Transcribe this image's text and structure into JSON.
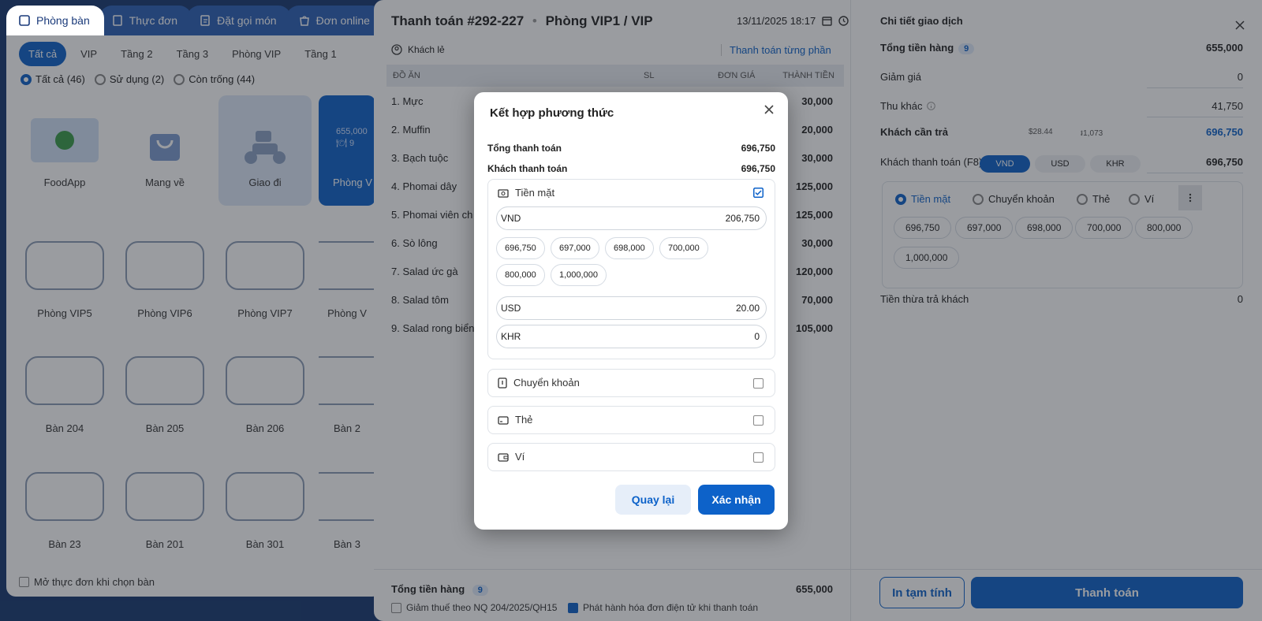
{
  "top_tabs": [
    {
      "label": "Phòng bàn"
    },
    {
      "label": "Thực đơn"
    },
    {
      "label": "Đặt gọi món"
    },
    {
      "label": "Đơn online"
    }
  ],
  "area_filters": [
    "Tất cả",
    "VIP",
    "Tầng 2",
    "Tầng 3",
    "Phòng VIP",
    "Tầng 1"
  ],
  "status_filters": [
    "Tất cả (46)",
    "Sử dụng (2)",
    "Còn trống (44)"
  ],
  "tiles": [
    {
      "label": "FoodApp"
    },
    {
      "label": "Mang về"
    },
    {
      "label": "Giao đi"
    },
    {
      "label": "Phòng V",
      "amount": "655,000",
      "count": "9"
    }
  ],
  "tables": [
    "Phòng VIP5",
    "Phòng VIP6",
    "Phòng VIP7",
    "Phòng V",
    "Bàn 204",
    "Bàn 205",
    "Bàn 206",
    "Bàn 2",
    "Bàn 23",
    "Bàn 201",
    "Bàn 301",
    "Bàn 3"
  ],
  "open_menu_label": "Mở thực đơn khi chọn bàn",
  "payment": {
    "title": "Thanh toán #292-227",
    "room": "Phòng VIP1 / VIP",
    "datetime": "13/11/2025 18:17",
    "customer": "Khách lẻ",
    "split_label": "Thanh toán từng phần",
    "columns": {
      "item": "ĐỒ ĂN",
      "qty": "SL",
      "price": "ĐƠN GIÁ",
      "total": "THÀNH TIỀN"
    },
    "items": [
      {
        "name": "1. Mực",
        "total": "30,000"
      },
      {
        "name": "2. Muffin",
        "total": "20,000"
      },
      {
        "name": "3. Bạch tuộc",
        "total": "30,000"
      },
      {
        "name": "4. Phomai dây",
        "total": "125,000"
      },
      {
        "name": "5. Phomai viên ch",
        "total": "125,000"
      },
      {
        "name": "6. Sò lông",
        "total": "30,000"
      },
      {
        "name": "7. Salad ức gà",
        "total": "120,000"
      },
      {
        "name": "8. Salad tôm",
        "total": "70,000"
      },
      {
        "name": "9. Salad rong biển",
        "total": "105,000"
      }
    ],
    "footer_total_label": "Tổng tiền hàng",
    "footer_count": "9",
    "footer_total": "655,000",
    "tax_label": "Giảm thuế theo NQ 204/2025/QH15",
    "einvoice_label": "Phát hành hóa đơn điện tử khi thanh toán"
  },
  "detail": {
    "title": "Chi tiết giao dịch",
    "total_goods_label": "Tổng tiền hàng",
    "total_goods_count": "9",
    "total_goods_value": "655,000",
    "discount_label": "Giảm giá",
    "discount_value": "0",
    "other_fee_label": "Thu khác",
    "other_fee_value": "41,750",
    "due_label": "Khách cần trả",
    "due_usd": "$28.44",
    "due_khr": "៛1,073",
    "due_value": "696,750",
    "paid_label": "Khách thanh toán (F8)",
    "currencies": [
      "VND",
      "USD",
      "KHR"
    ],
    "paid_value": "696,750",
    "methods": [
      "Tiền mặt",
      "Chuyển khoản",
      "Thẻ",
      "Ví"
    ],
    "quick_amounts": [
      "696,750",
      "697,000",
      "698,000",
      "700,000",
      "800,000",
      "1,000,000"
    ],
    "change_label": "Tiền thừa trả khách",
    "change_value": "0",
    "print_button": "In tạm tính",
    "pay_button": "Thanh toán"
  },
  "modal": {
    "title": "Kết hợp phương thức",
    "total_label": "Tổng thanh toán",
    "total_value": "696,750",
    "paid_label": "Khách thanh toán",
    "paid_value": "696,750",
    "cash_label": "Tiền mặt",
    "vnd_label": "VND",
    "vnd_value": "206,750",
    "quick_amounts": [
      "696,750",
      "697,000",
      "698,000",
      "700,000",
      "800,000",
      "1,000,000"
    ],
    "usd_label": "USD",
    "usd_value": "20.00",
    "khr_label": "KHR",
    "khr_value": "0",
    "transfer_label": "Chuyển khoản",
    "card_label": "Thẻ",
    "wallet_label": "Ví",
    "back_button": "Quay lại",
    "confirm_button": "Xác nhận"
  },
  "colors": {
    "primary": "#0d62c9",
    "navy": "#16386f"
  }
}
